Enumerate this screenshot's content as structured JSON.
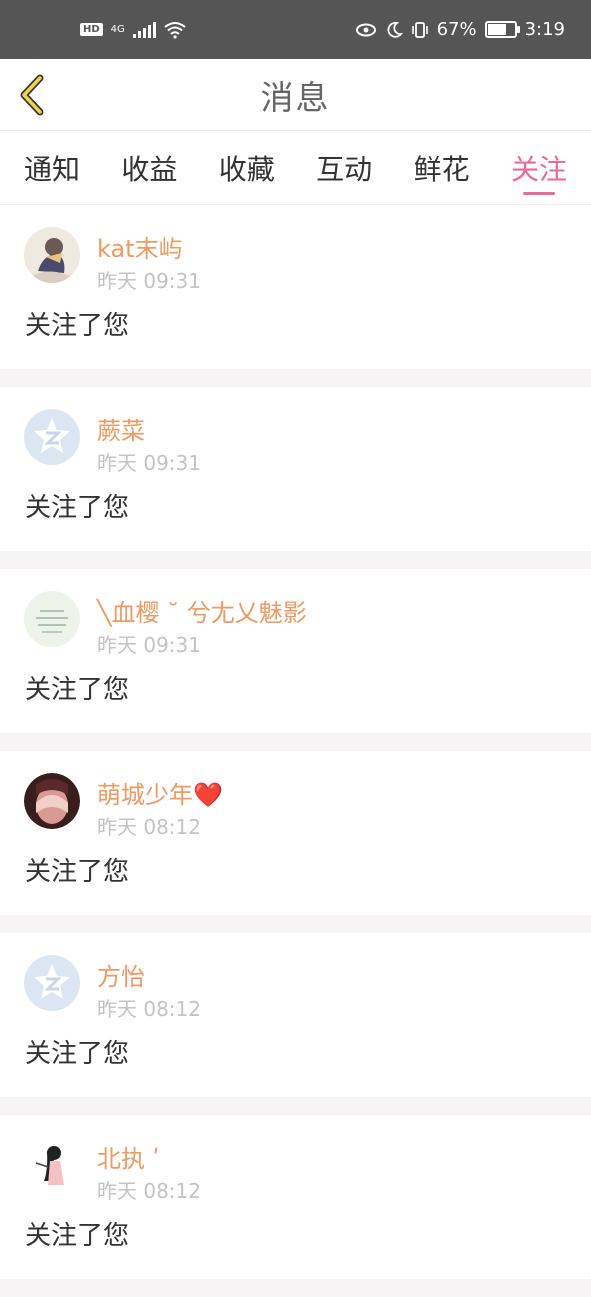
{
  "status_bar": {
    "hd": "HD",
    "network": "4G",
    "battery": "67%",
    "battery_level": 0.67,
    "time": "3:19"
  },
  "header": {
    "title": "消息",
    "back_icon": "chevron-left-icon",
    "accent_color": "#ea6b9a"
  },
  "tabs": [
    {
      "label": "通知",
      "active": false
    },
    {
      "label": "收益",
      "active": false
    },
    {
      "label": "收藏",
      "active": false
    },
    {
      "label": "互动",
      "active": false
    },
    {
      "label": "鲜花",
      "active": false
    },
    {
      "label": "关注",
      "active": true
    }
  ],
  "items": [
    {
      "name": "kat末屿",
      "time": "昨天 09:31",
      "message": "关注了您",
      "avatar": "anime-drawing-avatar"
    },
    {
      "name": "蕨菜",
      "time": "昨天 09:31",
      "message": "关注了您",
      "avatar": "default-qq-avatar"
    },
    {
      "name": "╲血樱 ˘ 兮尢乂魅影",
      "time": "昨天 09:31",
      "message": "关注了您",
      "avatar": "text-card-avatar"
    },
    {
      "name": "萌城少年",
      "time": "昨天 08:12",
      "message": "关注了您",
      "avatar": "hands-face-avatar",
      "emoji": "❤️"
    },
    {
      "name": "方怡",
      "time": "昨天 08:12",
      "message": "关注了您",
      "avatar": "default-qq-avatar"
    },
    {
      "name": "北执 ʹ",
      "time": "昨天 08:12",
      "message": "关注了您",
      "avatar": "girl-illustration-avatar"
    }
  ]
}
